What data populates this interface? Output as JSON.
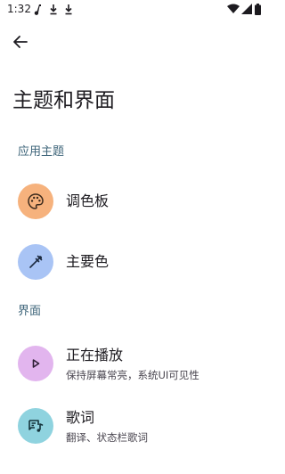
{
  "status_bar": {
    "time": "1:32"
  },
  "header": {
    "title": "主题和界面"
  },
  "sections": [
    {
      "header": "应用主题",
      "items": [
        {
          "title": "调色板",
          "icon": "palette-icon",
          "icon_bg": "#f6b27d"
        },
        {
          "title": "主要色",
          "icon": "eyedropper-icon",
          "icon_bg": "#a9c4f5"
        }
      ]
    },
    {
      "header": "界面",
      "items": [
        {
          "title": "正在播放",
          "subtitle": "保持屏幕常亮，系统UI可见性",
          "icon": "play-icon",
          "icon_bg": "#e2b5ee"
        },
        {
          "title": "歌词",
          "subtitle": "翻译、状态栏歌词",
          "icon": "lyrics-icon",
          "icon_bg": "#8fd3df"
        }
      ]
    }
  ],
  "colors": {
    "section_header": "#3d6479",
    "text_primary": "#1d1b20",
    "text_secondary": "#49454f"
  }
}
